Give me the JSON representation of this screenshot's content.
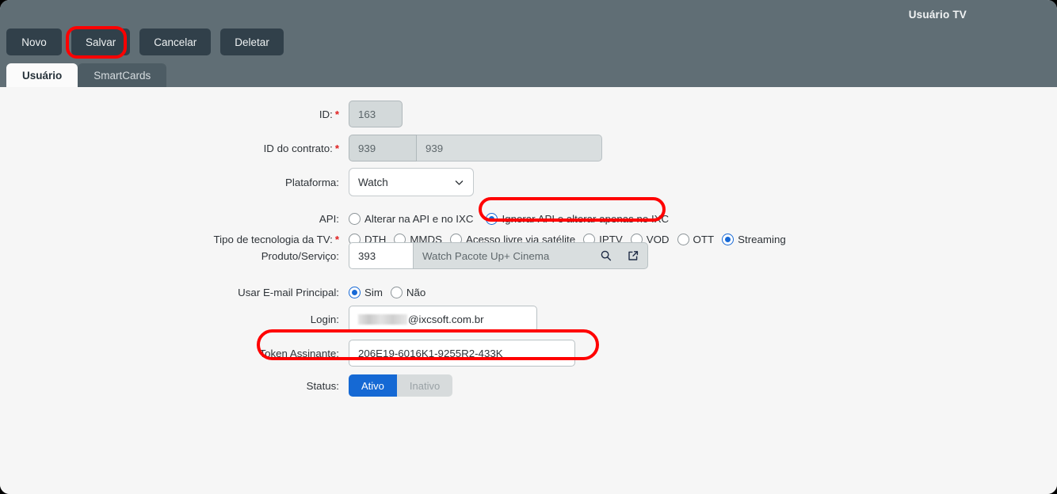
{
  "header": {
    "title": "Usuário TV",
    "buttons": [
      {
        "label": "Novo",
        "name": "novo-button"
      },
      {
        "label": "Salvar",
        "name": "salvar-button"
      },
      {
        "label": "Cancelar",
        "name": "cancelar-button"
      },
      {
        "label": "Deletar",
        "name": "deletar-button"
      }
    ],
    "tabs": [
      {
        "label": "Usuário",
        "active": true
      },
      {
        "label": "SmartCards",
        "active": false
      }
    ]
  },
  "form": {
    "id": {
      "label": "ID:",
      "required": "*",
      "value": "163"
    },
    "contrato": {
      "label": "ID do contrato:",
      "required": "*",
      "value": "939",
      "description": "939"
    },
    "plataforma": {
      "label": "Plataforma:",
      "value": "Watch",
      "icon": "chevron-down-icon"
    },
    "api": {
      "label": "API:",
      "options": [
        {
          "label": "Alterar na API e no IXC",
          "selected": false
        },
        {
          "label": "Ignorar API e alterar apenas no IXC",
          "selected": true
        }
      ]
    },
    "tecnologia": {
      "label": "Tipo de tecnologia da TV:",
      "required": "*",
      "options": [
        {
          "label": "DTH",
          "selected": false
        },
        {
          "label": "MMDS",
          "selected": false
        },
        {
          "label": "Acesso livre via satélite",
          "selected": false
        },
        {
          "label": "IPTV",
          "selected": false
        },
        {
          "label": "VOD",
          "selected": false
        },
        {
          "label": "OTT",
          "selected": false
        },
        {
          "label": "Streaming",
          "selected": true
        }
      ]
    },
    "produto": {
      "label": "Produto/Serviço:",
      "value": "393",
      "description": "Watch Pacote Up+ Cinema",
      "search_icon": "search-icon",
      "open_icon": "external-link-icon"
    },
    "email_principal": {
      "label": "Usar E-mail Principal:",
      "options": [
        {
          "label": "Sim",
          "selected": true
        },
        {
          "label": "Não",
          "selected": false
        }
      ]
    },
    "login": {
      "label": "Login:",
      "redacted": true,
      "value": "@ixcsoft.com.br"
    },
    "token": {
      "label": "Token Assinante:",
      "value": "206E19-6016K1-9255R2-433K"
    },
    "status": {
      "label": "Status:",
      "options": [
        {
          "label": "Ativo",
          "selected": true
        },
        {
          "label": "Inativo",
          "selected": false
        }
      ]
    }
  },
  "annotations": {
    "color": "#ff0000",
    "highlights": [
      {
        "name": "salvar-button-highlight"
      },
      {
        "name": "api-option-highlight"
      },
      {
        "name": "token-field-highlight"
      }
    ]
  }
}
